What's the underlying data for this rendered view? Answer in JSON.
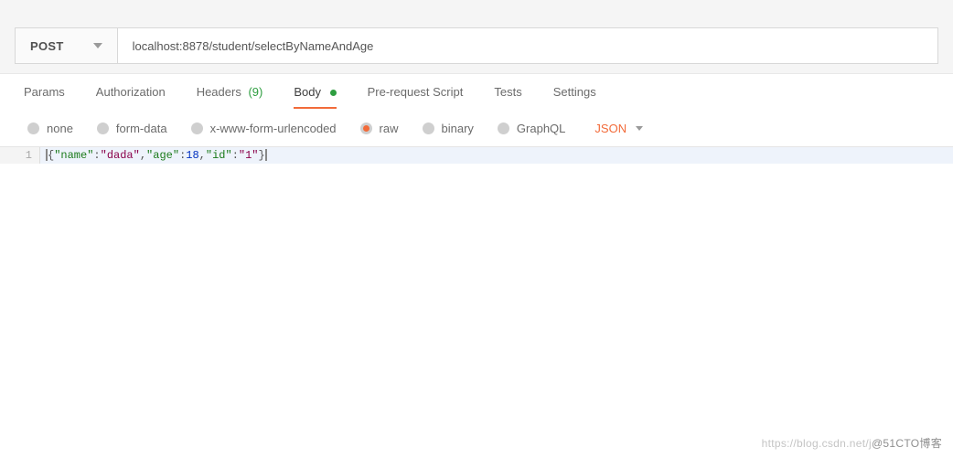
{
  "request": {
    "method": "POST",
    "url": "localhost:8878/student/selectByNameAndAge"
  },
  "tabs": {
    "params": "Params",
    "authorization": "Authorization",
    "headers": {
      "label": "Headers",
      "count": "(9)"
    },
    "body": "Body",
    "prerequest": "Pre-request Script",
    "tests": "Tests",
    "settings": "Settings"
  },
  "bodyTypes": {
    "none": "none",
    "formdata": "form-data",
    "urlencoded": "x-www-form-urlencoded",
    "raw": "raw",
    "binary": "binary",
    "graphql": "GraphQL",
    "format": "JSON"
  },
  "editor": {
    "line_number": "1",
    "body_raw": "{\"name\":\"dada\",\"age\":18,\"id\":\"1\"}",
    "tokens": {
      "open": "{",
      "k_name": "\"name\"",
      "v_name": "\"dada\"",
      "k_age": "\"age\"",
      "v_age": "18",
      "k_id": "\"id\"",
      "v_id": "\"1\"",
      "close": "}",
      "colon": ":",
      "comma": ","
    }
  },
  "watermark": {
    "faint": "https://blog.csdn.net/j",
    "dark": "@51CTO博客"
  }
}
